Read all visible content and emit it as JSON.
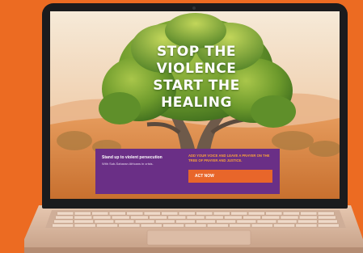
{
  "hero": {
    "headline_lines": [
      "STOP THE",
      "VIOLENCE",
      "START THE",
      "HEALING"
    ]
  },
  "panel": {
    "heading": "Stand up to violent persecution",
    "body": "With Sub-Saharan Africans in crisis.",
    "cta_text": "ADD YOUR VOICE AND LEAVE A PRAYER ON THE TREE OF PRAYER AND JUSTICE.",
    "button_label": "ACT NOW"
  },
  "colors": {
    "background": "#ec6b22",
    "panel": "#6a2f86",
    "cta_text": "#f7a13a",
    "button": "#e8662a",
    "laptop_body": "#d9b9a2",
    "bezel": "#1b1b1d"
  },
  "icons": {
    "decor": [
      "tree-illustration",
      "webcam-icon",
      "keyboard",
      "trackpad"
    ]
  }
}
